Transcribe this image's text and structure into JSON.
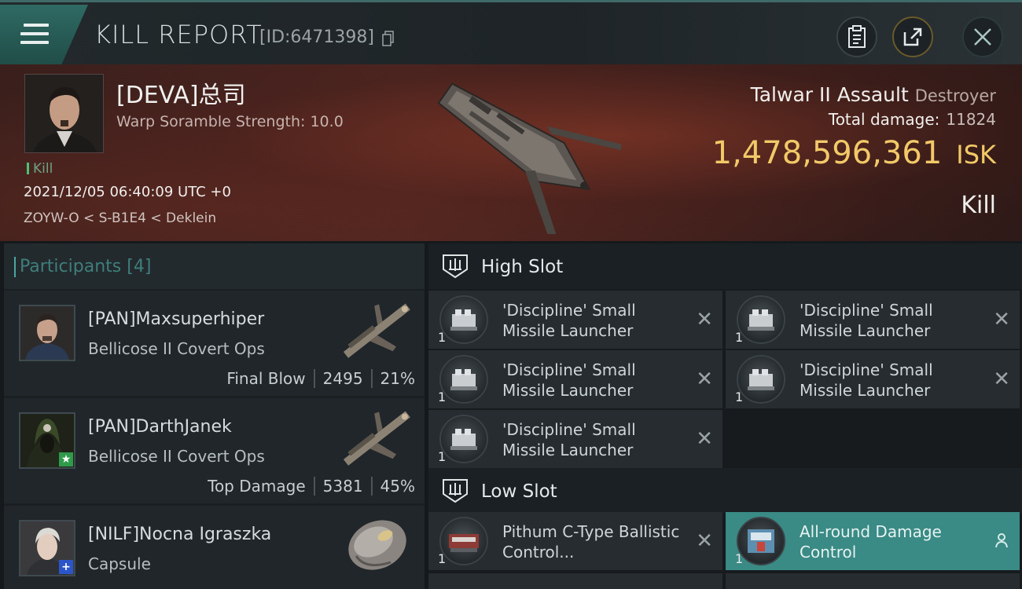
{
  "header": {
    "title": "KILL REPORT",
    "report_id": "[ID:6471398]",
    "icons": [
      "menu-icon",
      "copy-icon",
      "clipboard-icon",
      "share-icon",
      "close-icon"
    ]
  },
  "victim": {
    "name": "[DEVA]总司",
    "scramble": "Warp Soramble Strength: 10.0",
    "tag": "Kill",
    "time": "2021/12/05 06:40:09 UTC +0",
    "location": "ZOYW-O < S-B1E4 < Deklein",
    "ship_name": "Talwar II Assault",
    "ship_class": "Destroyer",
    "total_damage_label": "Total damage:",
    "total_damage": "11824",
    "isk_value": "1,478,596,361",
    "isk_unit": "ISK",
    "result": "Kill"
  },
  "participants": {
    "label": "Participants",
    "count": "[4]",
    "rows": [
      {
        "name": "[PAN]Maxsuperhiper",
        "ship": "Bellicose II Covert Ops",
        "role": "Final Blow",
        "damage": "2495",
        "percent": "21%"
      },
      {
        "name": "[PAN]DarthJanek",
        "ship": "Bellicose II Covert Ops",
        "role": "Top Damage",
        "damage": "5381",
        "percent": "45%"
      },
      {
        "name": "[NILF]Nocna Igraszka",
        "ship": "Capsule",
        "role": "",
        "damage": "",
        "percent": ""
      }
    ]
  },
  "high_slot": {
    "label": "High Slot",
    "modules": [
      {
        "name": "'Discipline' Small Missile Launcher",
        "qty": "1"
      },
      {
        "name": "'Discipline' Small Missile Launcher",
        "qty": "1"
      },
      {
        "name": "'Discipline' Small Missile Launcher",
        "qty": "1"
      },
      {
        "name": "'Discipline' Small Missile Launcher",
        "qty": "1"
      },
      {
        "name": "'Discipline' Small Missile Launcher",
        "qty": "1"
      }
    ]
  },
  "low_slot": {
    "label": "Low Slot",
    "modules": [
      {
        "name": "Pithum C-Type Ballistic Control...",
        "qty": "1"
      },
      {
        "name": "All-round Damage Control",
        "qty": "1"
      }
    ]
  },
  "colors": {
    "accent_teal": "#3a8a85",
    "isk_gold": "#f2c968",
    "kill_green": "#4fbf76"
  }
}
